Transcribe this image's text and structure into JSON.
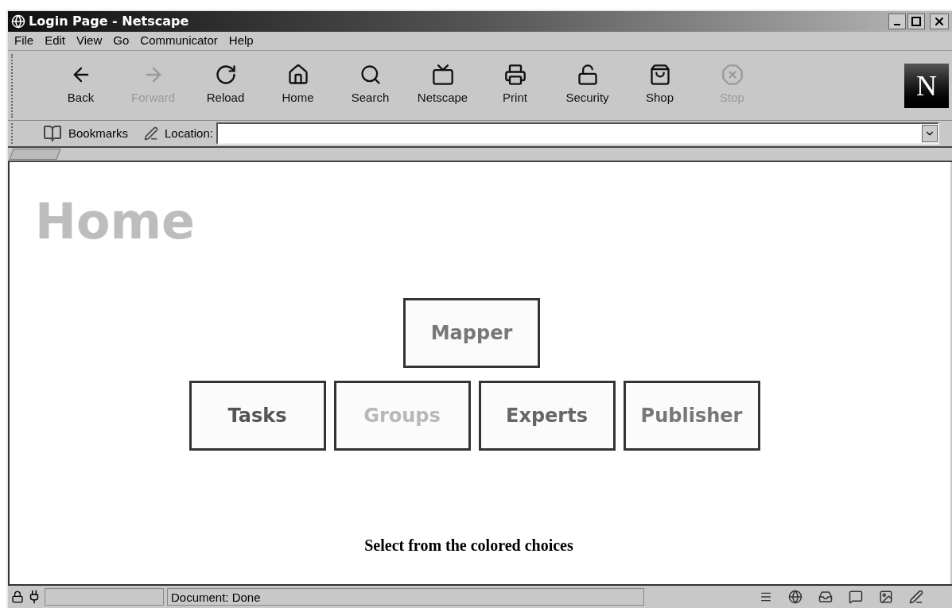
{
  "window": {
    "title": "Login Page - Netscape"
  },
  "menu": [
    "File",
    "Edit",
    "View",
    "Go",
    "Communicator",
    "Help"
  ],
  "toolbar": [
    {
      "label": "Back",
      "kind": "back",
      "disabled": false
    },
    {
      "label": "Forward",
      "kind": "forward",
      "disabled": true
    },
    {
      "label": "Reload",
      "kind": "reload",
      "disabled": false
    },
    {
      "label": "Home",
      "kind": "home",
      "disabled": false
    },
    {
      "label": "Search",
      "kind": "search",
      "disabled": false
    },
    {
      "label": "Netscape",
      "kind": "my",
      "disabled": false
    },
    {
      "label": "Print",
      "kind": "print",
      "disabled": false
    },
    {
      "label": "Security",
      "kind": "security",
      "disabled": false
    },
    {
      "label": "Shop",
      "kind": "shop",
      "disabled": false
    },
    {
      "label": "Stop",
      "kind": "stop",
      "disabled": true
    }
  ],
  "logo": {
    "letter": "N"
  },
  "location_bar": {
    "bookmarks": "Bookmarks",
    "location_label": "Location:"
  },
  "page": {
    "heading": "Home",
    "top_choices": [
      {
        "label": "Mapper",
        "color": "#777777"
      }
    ],
    "choices": [
      {
        "label": "Tasks",
        "color": "#555555"
      },
      {
        "label": "Groups",
        "color": "#b8b8b8"
      },
      {
        "label": "Experts",
        "color": "#666666"
      },
      {
        "label": "Publisher",
        "color": "#777777"
      }
    ],
    "footer": "Select from the colored choices"
  },
  "status_bar": {
    "text": "Document: Done"
  }
}
